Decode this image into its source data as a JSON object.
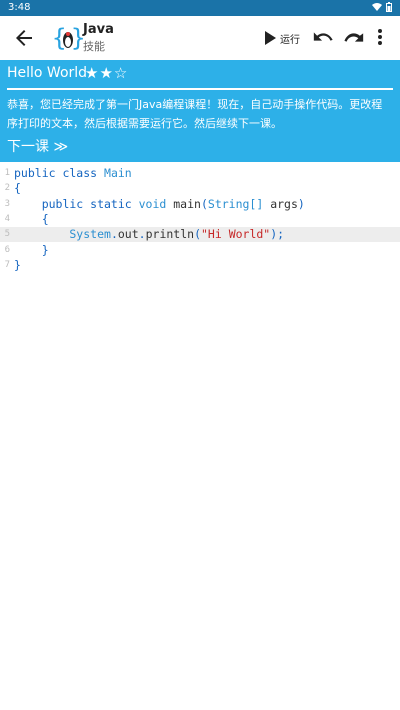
{
  "status_bar": {
    "time": "3:48"
  },
  "toolbar": {
    "title": "Java",
    "subtitle": "技能",
    "run_label": "运行"
  },
  "lesson": {
    "heading": "Hello World",
    "stars": "★★☆",
    "rating": {
      "filled": 2,
      "total": 3
    },
    "body": "恭喜，您已经完成了第一门Java编程课程！现在，自己动手操作代码。更改程序打印的文本，然后根据需要运行它。然后继续下一课。",
    "next": "下一课 ≫"
  },
  "editor": {
    "line_numbers": [
      "1",
      "2",
      "3",
      "4",
      "5",
      "6",
      "7"
    ],
    "lines": [
      [
        {
          "t": "public class ",
          "c": "kw"
        },
        {
          "t": "Main",
          "c": "type"
        }
      ],
      [
        {
          "t": "{",
          "c": "kw"
        }
      ],
      [
        {
          "t": "    public static ",
          "c": "kw"
        },
        {
          "t": "void ",
          "c": "type"
        },
        {
          "t": "main",
          "c": "plain"
        },
        {
          "t": "(",
          "c": "kw"
        },
        {
          "t": "String[]",
          "c": "type"
        },
        {
          "t": " args",
          "c": "plain"
        },
        {
          "t": ")",
          "c": "kw"
        }
      ],
      [
        {
          "t": "    {",
          "c": "kw"
        }
      ],
      [
        {
          "t": "        System",
          "c": "type"
        },
        {
          "t": ".",
          "c": "kw"
        },
        {
          "t": "out",
          "c": "plain"
        },
        {
          "t": ".",
          "c": "kw"
        },
        {
          "t": "println",
          "c": "plain"
        },
        {
          "t": "(",
          "c": "kw"
        },
        {
          "t": "\"Hi World\"",
          "c": "str"
        },
        {
          "t": ");",
          "c": "kw"
        }
      ],
      [
        {
          "t": "    }",
          "c": "kw"
        }
      ],
      [
        {
          "t": "}",
          "c": "kw"
        }
      ]
    ],
    "active_line": 5
  },
  "colors": {
    "status_bar": "#1a73a8",
    "lesson_bg": "#2db0e8",
    "keyword": "#1565c0",
    "string": "#c62828",
    "active_line": "#ededed"
  },
  "icons": [
    "back-arrow-icon",
    "java-logo-icon",
    "play-icon",
    "undo-icon",
    "redo-icon",
    "more-vert-icon",
    "wifi-icon",
    "battery-icon"
  ]
}
